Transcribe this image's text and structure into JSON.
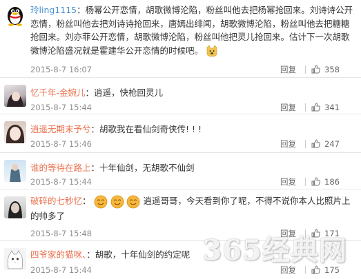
{
  "comments": [
    {
      "username": "玲ling1115",
      "text": "：杨幂公开恋情，胡歌微博沦陷，粉丝叫他去把杨幂抢回来。刘诗诗公开恋情，粉丝叫他去把刘诗诗抢回来，唐嫣出绯闻，胡歌微博沦陷，粉丝叫他去把糖糖抢回来。刘亦菲公开恋情，胡歌微博沦陷，粉丝叫他把灵儿抢回来。估计下一次胡歌微博沦陷盛况就是霍建华公开恋情的时候吧。",
      "time": "2015-8-7 16:07",
      "reply": "回复",
      "likes": "358"
    },
    {
      "username": "忆千年-金婉儿",
      "text": "：逍遥，快枪回灵儿",
      "time": "2015-8-7 15:44",
      "reply": "回复",
      "likes": "341"
    },
    {
      "username": "逍遥无期末予兮",
      "text": "：胡歌我在看仙剑奇侠传! ! !",
      "time": "2015-8-7 15:46",
      "reply": "回复",
      "likes": "247"
    },
    {
      "username": "谁的等待在路上",
      "text": "：十年仙剑，无胡歌不仙剑",
      "time": "2015-8-7 15:44",
      "reply": "回复",
      "likes": "186"
    },
    {
      "username": "破碎的七秒忆",
      "text": "逍遥哥哥，今天看到你了呢，不得不说你本人比照片上的帅多了",
      "time": "2015-8-7 15:48",
      "reply": "回复",
      "likes": "171"
    },
    {
      "username": "四爷家的猫咪、",
      "text": "：胡歌，十年仙剑的约定呢",
      "time": "2015-8-7 15:44",
      "reply": "回复",
      "likes": "175"
    }
  ],
  "watermark": "365经典网",
  "colors": {
    "username": "#eb7350",
    "username_alt": "#4a8fd0",
    "meta": "#8d8d8d"
  }
}
